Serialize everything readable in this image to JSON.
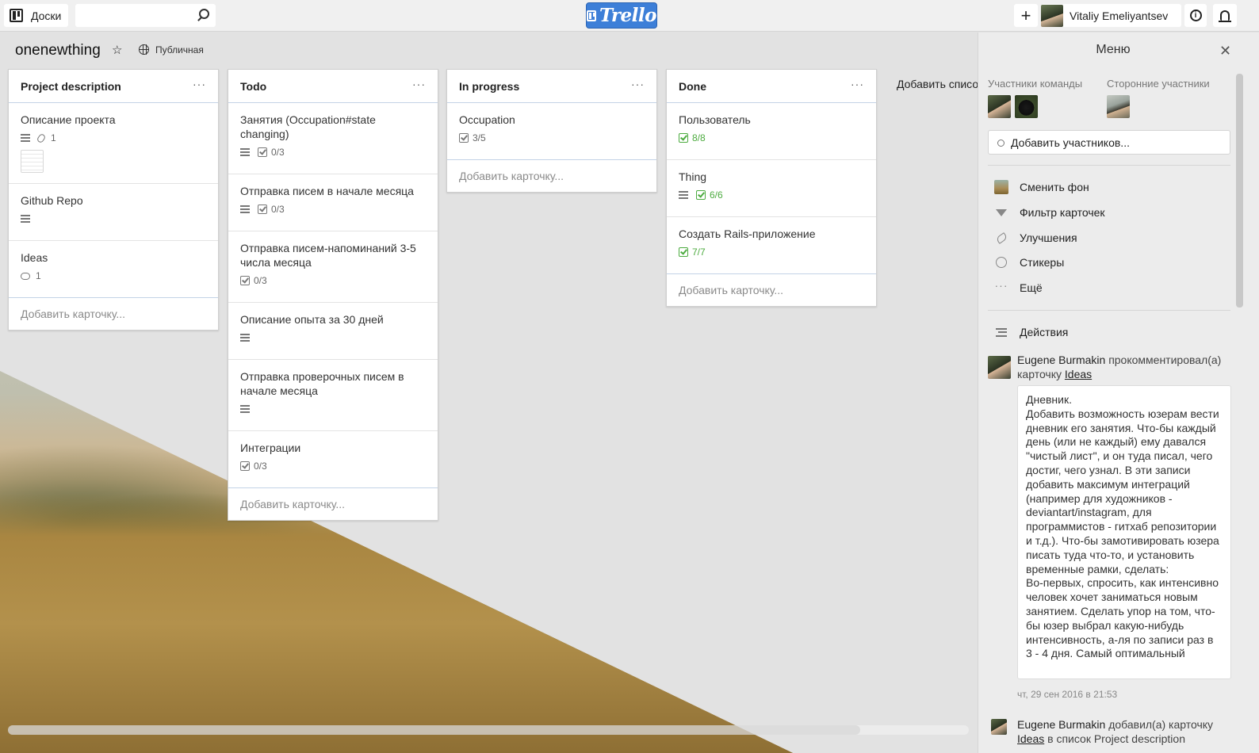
{
  "header": {
    "boards_label": "Доски",
    "search_value": "",
    "logo_text": "Trello",
    "add_label": "+",
    "user_name": "Vitaliy Emeliyantsev",
    "info_label": "i"
  },
  "board": {
    "title": "onenewthing",
    "visibility": "Публичная",
    "add_list_label": "Добавить список",
    "lists": [
      {
        "title": "Project description",
        "menu": "···",
        "cards": [
          {
            "title": "Описание проекта",
            "attachments": "1"
          },
          {
            "title": "Github Repo"
          },
          {
            "title": "Ideas",
            "comments": "1"
          }
        ],
        "add_card": "Добавить карточку..."
      },
      {
        "title": "Todo",
        "menu": "···",
        "cards": [
          {
            "title": "Занятия (Occupation#state changing)",
            "checklist": "0/3"
          },
          {
            "title": "Отправка писем в начале месяца",
            "checklist": "0/3"
          },
          {
            "title": "Отправка писем-напоминаний 3-5 числа месяца",
            "checklist": "0/3"
          },
          {
            "title": "Описание опыта за 30 дней"
          },
          {
            "title": "Отправка проверочных писем в начале месяца"
          },
          {
            "title": "Интеграции",
            "checklist": "0/3"
          }
        ],
        "add_card": "Добавить карточку..."
      },
      {
        "title": "In progress",
        "menu": "···",
        "cards": [
          {
            "title": "Occupation",
            "checklist": "3/5"
          }
        ],
        "add_card": "Добавить карточку..."
      },
      {
        "title": "Done",
        "menu": "···",
        "cards": [
          {
            "title": "Пользователь",
            "checklist": "8/8"
          },
          {
            "title": "Thing",
            "checklist": "6/6"
          },
          {
            "title": "Создать Rails-приложение",
            "checklist": "7/7"
          }
        ],
        "add_card": "Добавить карточку..."
      }
    ]
  },
  "sidebar": {
    "title": "Меню",
    "team_members_label": "Участники команды",
    "external_members_label": "Сторонние участники",
    "add_members_label": "Добавить участников...",
    "menu_items": [
      "Сменить фон",
      "Фильтр карточек",
      "Улучшения",
      "Стикеры",
      "Ещё"
    ],
    "actions_label": "Действия",
    "activity": [
      {
        "user": "Eugene Burmakin",
        "text": "прокомментировал(а) карточку",
        "card": "Ideas",
        "comment": "Дневник.\nДобавить возможность юзерам вести дневник его занятия. Что-бы каждый день (или не каждый) ему давался \"чистый лист\", и он туда писал, чего достиг, чего узнал. В эти записи добавить максимум интеграций (например для художников - deviantart/instagram, для программистов - гитхаб репозитории и т.д.). Что-бы замотивировать юзера писать туда что-то, и установить временные рамки, сделать:\nВо-первых, спросить, как интенсивно человек хочет заниматься новым занятием. Сделать упор на том, что-бы юзер выбрал какую-нибудь интенсивность, а-ля по записи раз в 3 - 4 дня. Самый оптимальный",
        "date": "чт, 29 сен 2016 в 21:53"
      },
      {
        "user": "Eugene Burmakin",
        "text": "добавил(а) карточку",
        "card": "Ideas",
        "text2": "в список Project description"
      }
    ]
  },
  "colors": {
    "logo": "#3d7fd8",
    "done_green": "#4cab3f",
    "board_bg": "#e2e2e2"
  }
}
